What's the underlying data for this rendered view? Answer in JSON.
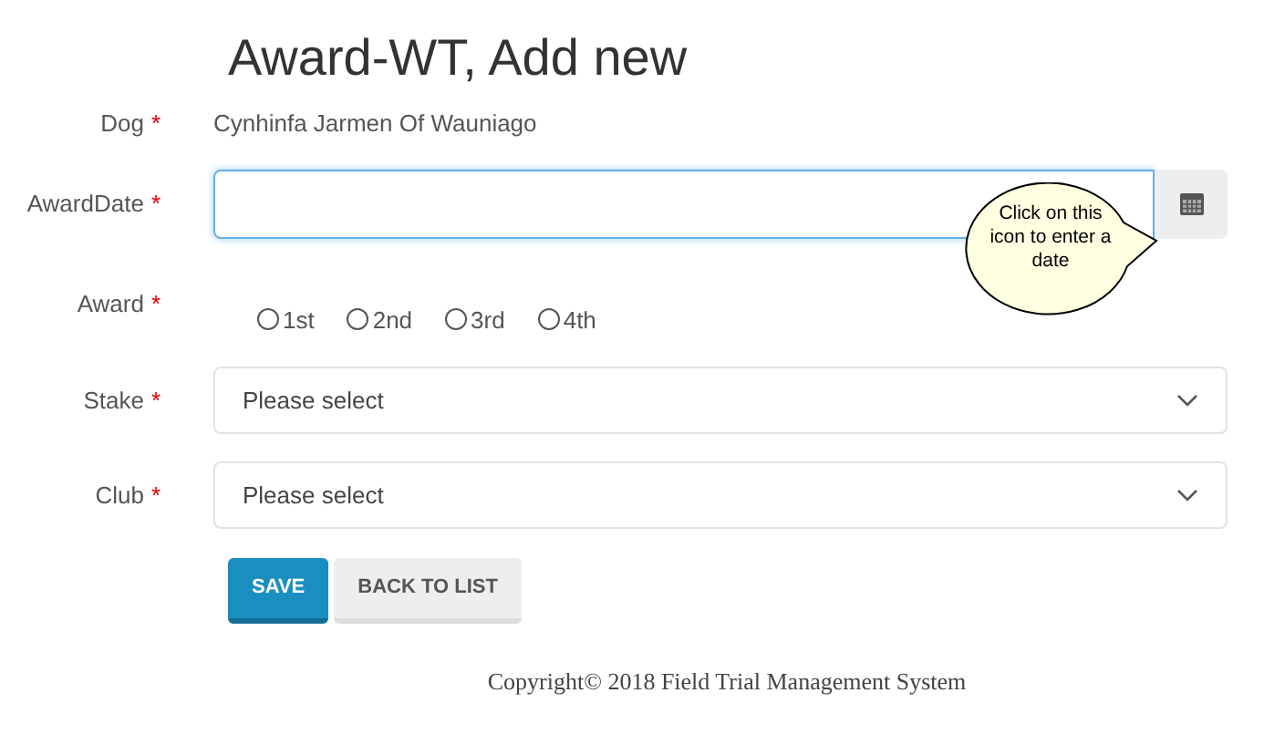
{
  "title": "Award-WT, Add new",
  "dog": {
    "label": "Dog",
    "required_mark": "*",
    "value": "Cynhinfa Jarmen Of Wauniago"
  },
  "award_date": {
    "label": "AwardDate",
    "required_mark": "*",
    "callout": "Click on this icon to enter a date"
  },
  "award": {
    "label": "Award",
    "required_mark": "*",
    "options": [
      {
        "label": "1st",
        "selected": false
      },
      {
        "label": "2nd",
        "selected": false
      },
      {
        "label": "3rd",
        "selected": false
      },
      {
        "label": "4th",
        "selected": false
      }
    ]
  },
  "selects": [
    {
      "label": "Stake",
      "required_mark": "*",
      "value": "Please select"
    },
    {
      "label": "Club",
      "required_mark": "*",
      "value": "Please select"
    }
  ],
  "buttons": [
    {
      "label": "SAVE",
      "kind": "primary"
    },
    {
      "label": "BACK TO LIST",
      "kind": "secondary"
    }
  ],
  "footer": "Copyright© 2018 Field Trial Management System"
}
